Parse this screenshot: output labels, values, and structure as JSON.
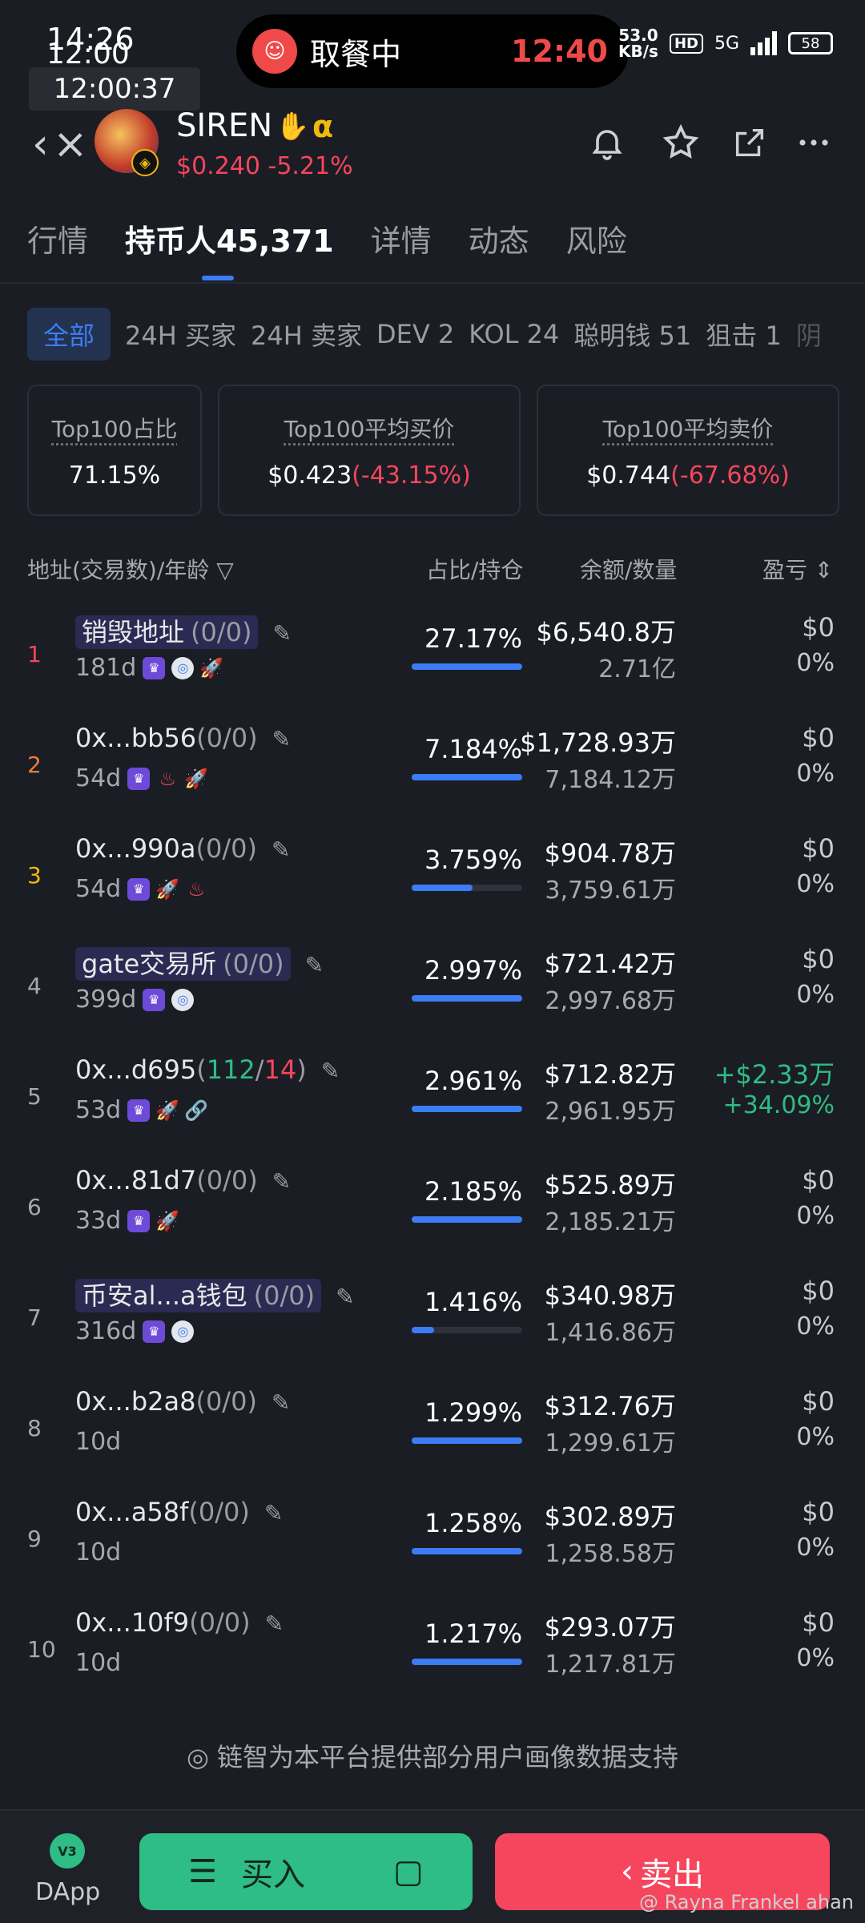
{
  "status_bar": {
    "time_a": "14:26",
    "time_b": "12:00",
    "clock": "12:00:37",
    "activity": "取餐中",
    "activity_time": "12:40",
    "net_speed_top": "53.0",
    "net_speed_bottom": "KB/s",
    "hd": "HD",
    "signal": "5G",
    "battery": "58"
  },
  "header": {
    "token_name": "SIREN",
    "alpha": "α",
    "price_change": "$0.240 -5.21%",
    "icons": [
      "bell-icon",
      "star-icon",
      "share-icon",
      "more-icon"
    ]
  },
  "tabs": [
    {
      "label": "行情"
    },
    {
      "label": "持币人45,371"
    },
    {
      "label": "详情"
    },
    {
      "label": "动态"
    },
    {
      "label": "风险"
    }
  ],
  "filters": [
    "全部",
    "24H 买家",
    "24H 卖家",
    "DEV 2",
    "KOL 24",
    "聪明钱 51",
    "狙击 1",
    "阴"
  ],
  "stats": [
    {
      "title": "Top100占比",
      "value": "71.15%",
      "change": ""
    },
    {
      "title": "Top100平均买价",
      "value": "$0.423",
      "change": "(-43.15%)"
    },
    {
      "title": "Top100平均卖价",
      "value": "$0.744",
      "change": "(-67.68%)"
    }
  ],
  "table_headers": {
    "address": "地址(交易数)/年龄",
    "share": "占比/持仓",
    "balance": "余额/数量",
    "pnl": "盈亏"
  },
  "holders": [
    {
      "rank": "1",
      "address": "销毁地址",
      "count": "(0/0)",
      "age": "181d",
      "pct": "27.17%",
      "pct_value": 100,
      "balance": "$6,540.8万",
      "qty": "2.71亿",
      "pnl": "$0",
      "pnl_pct": "0%"
    },
    {
      "rank": "2",
      "address": "0x...bb56",
      "count": "(0/0)",
      "age": "54d",
      "pct": "7.184%",
      "pct_value": 100,
      "balance": "$1,728.93万",
      "qty": "7,184.12万",
      "pnl": "$0",
      "pnl_pct": "0%"
    },
    {
      "rank": "3",
      "address": "0x...990a",
      "count": "(0/0)",
      "age": "54d",
      "pct": "3.759%",
      "pct_value": 55,
      "balance": "$904.78万",
      "qty": "3,759.61万",
      "pnl": "$0",
      "pnl_pct": "0%"
    },
    {
      "rank": "4",
      "address": "gate交易所",
      "count": "(0/0)",
      "age": "399d",
      "pct": "2.997%",
      "pct_value": 100,
      "balance": "$721.42万",
      "qty": "2,997.68万",
      "pnl": "$0",
      "pnl_pct": "0%"
    },
    {
      "rank": "5",
      "address": "0x...d695",
      "count_buy": "112",
      "count_sell": "14",
      "age": "53d",
      "pct": "2.961%",
      "pct_value": 100,
      "balance": "$712.82万",
      "qty": "2,961.95万",
      "pnl": "+$2.33万",
      "pnl_pct": "+34.09%"
    },
    {
      "rank": "6",
      "address": "0x...81d7",
      "count": "(0/0)",
      "age": "33d",
      "pct": "2.185%",
      "pct_value": 100,
      "balance": "$525.89万",
      "qty": "2,185.21万",
      "pnl": "$0",
      "pnl_pct": "0%"
    },
    {
      "rank": "7",
      "address": "币安al...a钱包",
      "count": "(0/0)",
      "age": "316d",
      "pct": "1.416%",
      "pct_value": 20,
      "balance": "$340.98万",
      "qty": "1,416.86万",
      "pnl": "$0",
      "pnl_pct": "0%"
    },
    {
      "rank": "8",
      "address": "0x...b2a8",
      "count": "(0/0)",
      "age": "10d",
      "pct": "1.299%",
      "pct_value": 100,
      "balance": "$312.76万",
      "qty": "1,299.61万",
      "pnl": "$0",
      "pnl_pct": "0%"
    },
    {
      "rank": "9",
      "address": "0x...a58f",
      "count": "(0/0)",
      "age": "10d",
      "pct": "1.258%",
      "pct_value": 100,
      "balance": "$302.89万",
      "qty": "1,258.58万",
      "pnl": "$0",
      "pnl_pct": "0%"
    },
    {
      "rank": "10",
      "address": "0x...10f9",
      "count": "(0/0)",
      "age": "10d",
      "pct": "1.217%",
      "pct_value": 100,
      "balance": "$293.07万",
      "qty": "1,217.81万",
      "pnl": "$0",
      "pnl_pct": "0%"
    }
  ],
  "footer": {
    "note": "链智为本平台提供部分用户画像数据支持",
    "dapp_badge": "V3",
    "dapp": "DApp",
    "buy": "买入",
    "sell": "卖出",
    "watermark": "@ Rayna Frankel ahan"
  },
  "colors": {
    "accent": "#3c7cf4",
    "up": "#2ebd85",
    "down": "#f6465d",
    "background": "#1b1d24"
  }
}
